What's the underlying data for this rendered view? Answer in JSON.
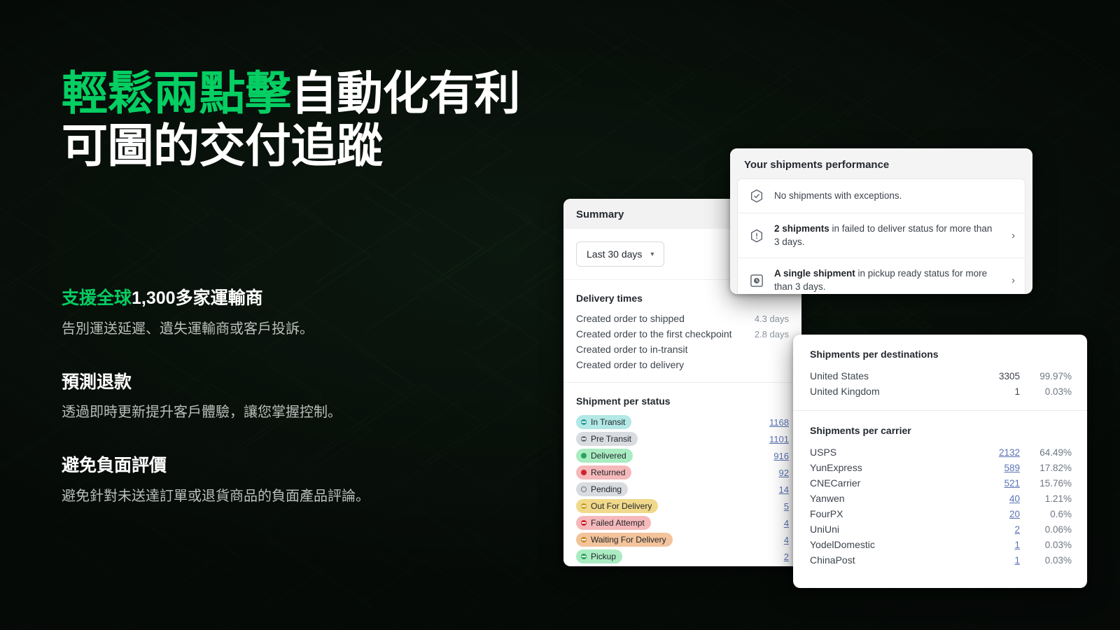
{
  "theme": {
    "accent_green": "#05ce62",
    "background": "#080c09",
    "heading_white": "#ffffff",
    "body_gray": "#b9bfbb",
    "link_blue": "#5a73b4"
  },
  "hero": {
    "line1_accent": "輕鬆兩點擊",
    "line1_rest": "自動化有利",
    "line2": "可圖的交付追蹤"
  },
  "features": [
    {
      "title_accent": "支援全球",
      "title_rest": "1,300多家運輸商",
      "body": "告別運送延遲、遺失運輸商或客戶投訴。"
    },
    {
      "title_accent": "",
      "title_rest": "預測退款",
      "body": "透過即時更新提升客戶體驗，讓您掌握控制。"
    },
    {
      "title_accent": "",
      "title_rest": "避免負面評價",
      "body": "避免針對未送達訂單或退貨商品的負面產品評論。"
    }
  ],
  "summary_card": {
    "title": "Summary",
    "date_range": {
      "label": "Last 30 days",
      "icon": "chevron-down-icon"
    },
    "delivery_times": {
      "title": "Delivery times",
      "rows": [
        {
          "label": "Created order to shipped",
          "value": "4.3 days"
        },
        {
          "label": "Created order to the first checkpoint",
          "value": "2.8 days"
        },
        {
          "label": "Created order to in-transit",
          "value": ""
        },
        {
          "label": "Created order to delivery",
          "value": ""
        }
      ]
    },
    "shipment_per_status": {
      "title": "Shipment per status",
      "rows": [
        {
          "label": "In Transit",
          "count": "1168",
          "bg": "#b2e8e6",
          "dot": "#2a9d9a",
          "dot_style": "dash"
        },
        {
          "label": "Pre Transit",
          "count": "1101",
          "bg": "#d8dce0",
          "dot": "#6e7781",
          "dot_style": "dash"
        },
        {
          "label": "Delivered",
          "count": "916",
          "bg": "#a9ecc2",
          "dot": "#2aa35b",
          "dot_style": "solid"
        },
        {
          "label": "Returned",
          "count": "92",
          "bg": "#f5b9bb",
          "dot": "#cf222e",
          "dot_style": "solid"
        },
        {
          "label": "Pending",
          "count": "14",
          "bg": "#d8dce0",
          "dot": "#6e7781",
          "dot_style": "hollow"
        },
        {
          "label": "Out For Delivery",
          "count": "5",
          "bg": "#f0d98a",
          "dot": "#c9a227",
          "dot_style": "dash"
        },
        {
          "label": "Failed Attempt",
          "count": "4",
          "bg": "#f5b9bb",
          "dot": "#cf222e",
          "dot_style": "dash"
        },
        {
          "label": "Waiting For Delivery",
          "count": "4",
          "bg": "#f3c39b",
          "dot": "#c98a27",
          "dot_style": "dash"
        },
        {
          "label": "Pickup",
          "count": "2",
          "bg": "#a9ecc2",
          "dot": "#2aa35b",
          "dot_style": "dash"
        }
      ]
    }
  },
  "performance_card": {
    "title": "Your shipments performance",
    "items": [
      {
        "icon": "hexagon-check-icon",
        "bold": "",
        "text": "No shipments with exceptions.",
        "arrow": false
      },
      {
        "icon": "hexagon-alert-icon",
        "bold": "2 shipments",
        "text": " in failed to deliver status for more than 3 days.",
        "arrow": true,
        "arrow_icon": "chevron-right-icon"
      },
      {
        "icon": "clock-box-icon",
        "bold": "A single shipment",
        "text": " in pickup ready status for more than 3 days.",
        "arrow": true,
        "arrow_icon": "chevron-right-icon"
      }
    ]
  },
  "destinations_card": {
    "destinations": {
      "title": "Shipments per destinations",
      "rows": [
        {
          "name": "United States",
          "count": "3305",
          "pct": "99.97%",
          "link": false
        },
        {
          "name": "United Kingdom",
          "count": "1",
          "pct": "0.03%",
          "link": false
        }
      ]
    },
    "carriers": {
      "title": "Shipments per carrier",
      "rows": [
        {
          "name": "USPS",
          "count": "2132",
          "pct": "64.49%",
          "link": true
        },
        {
          "name": "YunExpress",
          "count": "589",
          "pct": "17.82%",
          "link": true
        },
        {
          "name": "CNECarrier",
          "count": "521",
          "pct": "15.76%",
          "link": true
        },
        {
          "name": "Yanwen",
          "count": "40",
          "pct": "1.21%",
          "link": true
        },
        {
          "name": "FourPX",
          "count": "20",
          "pct": "0.6%",
          "link": true
        },
        {
          "name": "UniUni",
          "count": "2",
          "pct": "0.06%",
          "link": true
        },
        {
          "name": "YodelDomestic",
          "count": "1",
          "pct": "0.03%",
          "link": true
        },
        {
          "name": "ChinaPost",
          "count": "1",
          "pct": "0.03%",
          "link": true
        }
      ]
    }
  }
}
